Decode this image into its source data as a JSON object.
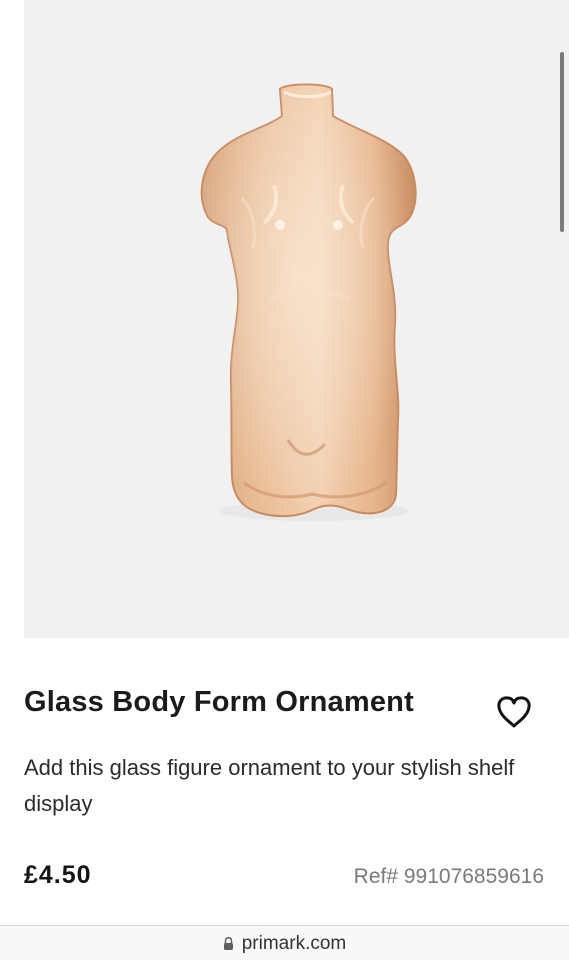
{
  "product": {
    "image_alt": "Glass body form ornament",
    "title": "Glass Body Form Ornament",
    "description": "Add this glass figure ornament to your stylish shelf display",
    "price": "£4.50",
    "reference": "Ref# 991076859616"
  },
  "browser": {
    "url": "primark.com"
  },
  "icons": {
    "wishlist": "heart-outline-icon",
    "security": "lock-icon"
  },
  "colors": {
    "image_background": "#f1f1f1",
    "text_primary": "#1b1b1b",
    "text_secondary": "#7a7a7a",
    "glass_tint": "#d9a77d"
  }
}
